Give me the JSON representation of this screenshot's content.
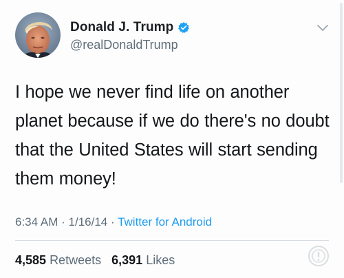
{
  "tweet": {
    "author": {
      "display_name": "Donald J. Trump",
      "handle": "@realDonaldTrump",
      "verified": true
    },
    "text": "I hope we never find life on another planet because if we do there's no doubt that the United States will start sending them money!",
    "meta": {
      "time": "6:34 AM",
      "separator": "·",
      "date": "1/16/14",
      "source": "Twitter for Android"
    },
    "stats": {
      "retweets_count": "4,585",
      "retweets_label": "Retweets",
      "likes_count": "6,391",
      "likes_label": "Likes"
    }
  },
  "icons": {
    "verified": "verified-badge-icon",
    "caret": "chevron-down-icon",
    "watermark": "info-watermark-icon"
  },
  "colors": {
    "link": "#1d9bf0",
    "muted": "#5e6d79",
    "text": "#14171a",
    "verified_badge": "#1da1f2"
  }
}
